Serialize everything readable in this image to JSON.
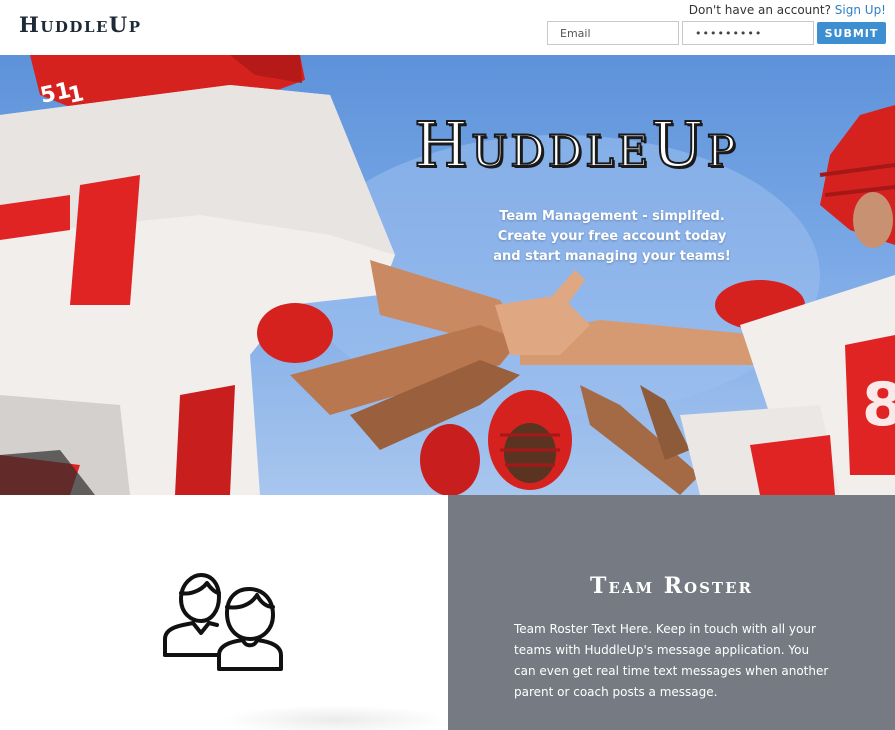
{
  "header": {
    "logo": "HuddleUp",
    "signup_prompt": "Don't have an account?",
    "signup_link": "Sign Up!",
    "email_placeholder": "Email",
    "password_value": "•••••••••",
    "submit_label": "SUBMIT"
  },
  "hero": {
    "title": "HuddleUp",
    "tagline": "Team Management - simplifed. Create your free account today and start managing your teams!",
    "jersey_numbers": [
      "51",
      "1",
      "8"
    ]
  },
  "feature": {
    "icon": "team-roster-icon",
    "title": "Team Roster",
    "text": "Team Roster Text Here. Keep in touch with all your teams with HuddleUp's message application. You can even get real time text messages when another parent or coach posts a message."
  },
  "colors": {
    "accent": "#3e8fd1",
    "link": "#2e7fc4",
    "feature_panel": "#767b83",
    "jersey_red": "#e02424"
  }
}
